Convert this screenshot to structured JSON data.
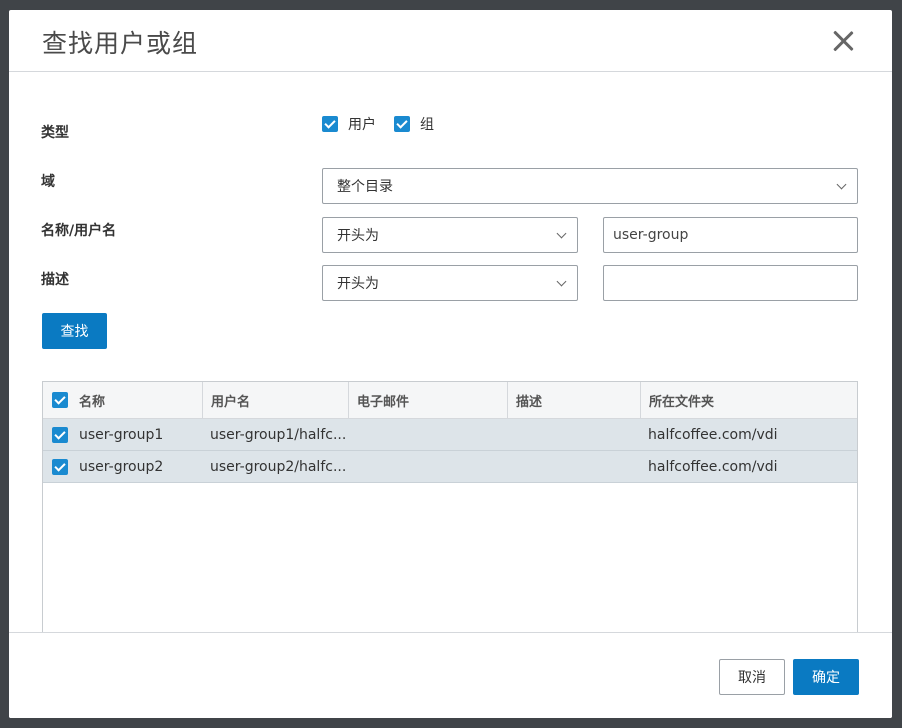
{
  "dialog": {
    "title": "查找用户或组"
  },
  "form": {
    "type_label": "类型",
    "type_options": [
      {
        "label": "用户",
        "checked": true
      },
      {
        "label": "组",
        "checked": true
      }
    ],
    "domain_label": "域",
    "domain_value": "整个目录",
    "name_label": "名称/用户名",
    "name_match": "开头为",
    "name_value": "user-group",
    "desc_label": "描述",
    "desc_match": "开头为",
    "desc_value": "",
    "find_button": "查找"
  },
  "results": {
    "select_all_checked": true,
    "columns": [
      "名称",
      "用户名",
      "电子邮件",
      "描述",
      "所在文件夹"
    ],
    "rows": [
      {
        "checked": true,
        "name": "user-group1",
        "username": "user-group1/halfc...",
        "email": "",
        "description": "",
        "folder": "halfcoffee.com/vdi"
      },
      {
        "checked": true,
        "name": "user-group2",
        "username": "user-group2/halfc...",
        "email": "",
        "description": "",
        "folder": "halfcoffee.com/vdi"
      }
    ]
  },
  "footer": {
    "cancel_label": "取消",
    "ok_label": "确定"
  },
  "colors": {
    "primary": "#0a7ac2",
    "checkbox": "#1a8ad0",
    "row_selected": "#dde4e9",
    "backdrop": "#404448"
  }
}
